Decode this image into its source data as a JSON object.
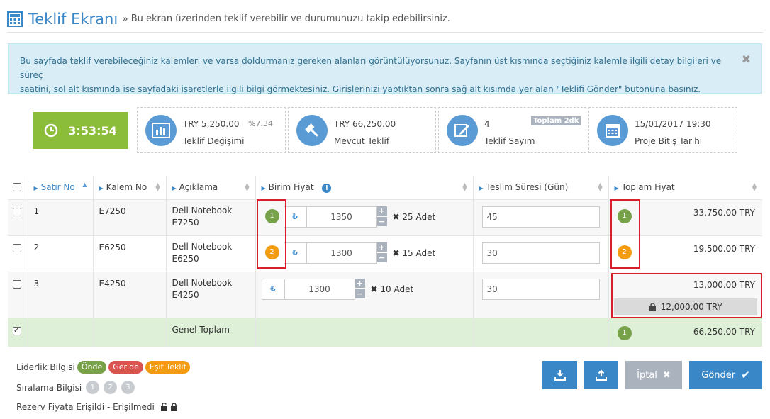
{
  "header": {
    "title": "Teklif Ekranı",
    "separator": "»",
    "subtitle": "Bu ekran üzerinden teklif verebilir ve durumunuzu takip edebilirsiniz."
  },
  "alert": {
    "line1": "Bu sayfada teklif verebileceğiniz kalemleri ve varsa doldurmanız gereken alanları görüntülüyorsunuz. Sayfanın üst kısmında seçtiğiniz kalemle ilgili detay bilgileri ve süreç",
    "line2": "saatini, sol alt kısmında ise sayfadaki işaretlerle ilgili bilgi görmektesiniz. Girişlerinizi yaptıktan sonra sağ alt kısımda yer alan \"Teklifi Gönder\" butonuna basınız.",
    "close": "✖"
  },
  "timer": {
    "value": "3:53:54"
  },
  "stats": {
    "change": {
      "value": "TRY 5,250.00",
      "percent": "%7.34",
      "label": "Teklif Değişimi"
    },
    "current": {
      "value": "TRY 66,250.00",
      "label": "Mevcut Teklif"
    },
    "count": {
      "value": "4",
      "tag": "Toplam 2dk",
      "label": "Teklif Sayım"
    },
    "end": {
      "value": "15/01/2017 19:30",
      "label": "Proje Bitiş Tarihi"
    }
  },
  "table": {
    "headers": {
      "row_no": "Satır No",
      "item_no": "Kalem No",
      "desc": "Açıklama",
      "unit_price": "Birim Fiyat",
      "delivery": "Teslim Süresi (Gün)",
      "total": "Toplam Fiyat"
    },
    "currency_symbol": "₺",
    "rows": [
      {
        "no": "1",
        "item": "E7250",
        "desc1": "Dell Notebook",
        "desc2": "E7250",
        "rank": "1",
        "price": "1350",
        "qty": "25 Adet",
        "days": "45",
        "total_rank": "1",
        "total": "33,750.00 TRY"
      },
      {
        "no": "2",
        "item": "E6250",
        "desc1": "Dell Notebook",
        "desc2": "E6250",
        "rank": "2",
        "price": "1300",
        "qty": "15 Adet",
        "days": "30",
        "total_rank": "2",
        "total": "19,500.00 TRY"
      },
      {
        "no": "3",
        "item": "E4250",
        "desc1": "Dell Notebook",
        "desc2": "E4250",
        "price": "1300",
        "qty": "10 Adet",
        "days": "30",
        "total": "13,000.00 TRY",
        "reserve": "12,000.00 TRY"
      }
    ],
    "footer": {
      "label": "Genel Toplam",
      "rank": "1",
      "total": "66,250.00 TRY"
    }
  },
  "legend": {
    "leadership_label": "Liderlik Bilgisi",
    "ahead": "Önde",
    "behind": "Geride",
    "equal": "Eşit Teklif",
    "ranking_label": "Sıralama Bilgisi",
    "ranks": [
      "1",
      "2",
      "3"
    ],
    "reserve_label": "Rezerv Fiyata Erişildi - Erişilmedi"
  },
  "buttons": {
    "cancel": "İptal",
    "send": "Gönder"
  },
  "colors": {
    "primary": "#3a87c8",
    "green": "#78a24a",
    "red": "#d9534f",
    "orange": "#f39c12",
    "timer": "#8cbd3a"
  }
}
